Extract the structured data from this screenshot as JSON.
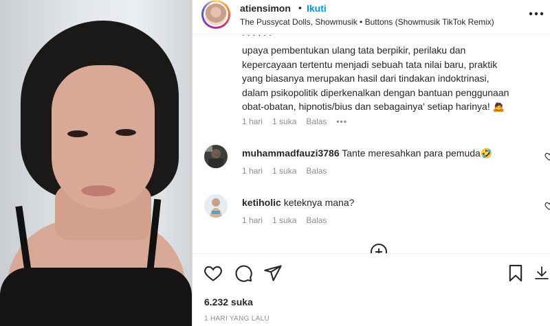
{
  "header": {
    "username": "atiensimon",
    "separator": "•",
    "follow_label": "Ikuti",
    "audio": "The Pussycat Dolls, Showmusik • Buttons (Showmusik TikTok Remix)"
  },
  "comments": {
    "first": {
      "text_lines": [
        "upaya pembentukan ulang tata berpikir, perilaku dan",
        "kepercayaan tertentu menjadi sebuah tata nilai baru, praktik",
        "yang biasanya merupakan hasil dari tindakan indoktrinasi,",
        "dalam psikopolitik diperkenalkan dengan bantuan penggunaan",
        "obat-obatan, hipnotis/bius dan sebagainya' setiap harinya! 🙇"
      ],
      "time": "1 hari",
      "likes": "1 suka",
      "reply": "Balas",
      "more": "•••"
    },
    "items": [
      {
        "user": "muhammadfauzi3786",
        "text": "Tante meresahkan para pemuda🤣",
        "time": "1 hari",
        "likes": "1 suka",
        "reply": "Balas"
      },
      {
        "user": "ketiholic",
        "text": "keteknya mana?",
        "time": "1 hari",
        "likes": "1 suka",
        "reply": "Balas"
      }
    ]
  },
  "stats": {
    "likes": "6.232 suka",
    "time_ago": "1 HARI YANG LALU"
  },
  "icons": {
    "like": "heart-icon",
    "comment": "comment-icon",
    "share": "paper-plane-icon",
    "save": "bookmark-icon",
    "more": "more-horizontal-icon"
  }
}
